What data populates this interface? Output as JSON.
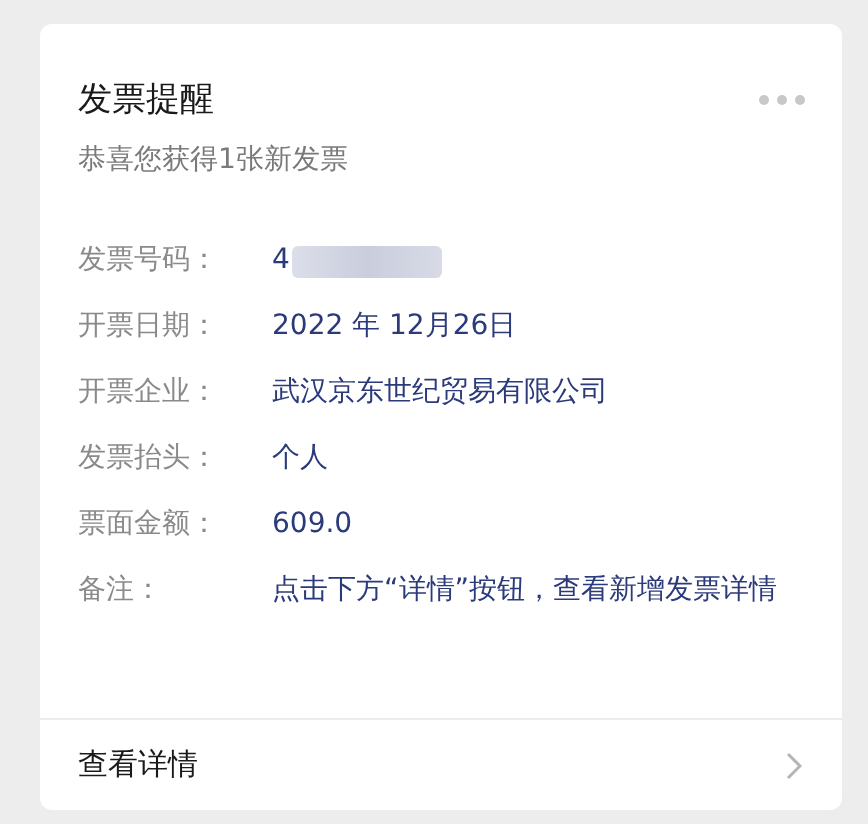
{
  "card": {
    "title": "发票提醒",
    "subtitle": "恭喜您获得1张新发票",
    "fields": [
      {
        "label": "发票号码：",
        "value": "4",
        "redacted": true
      },
      {
        "label": "开票日期：",
        "value": "2022 年 12月26日",
        "redacted": false
      },
      {
        "label": "开票企业：",
        "value": "武汉京东世纪贸易有限公司",
        "redacted": false
      },
      {
        "label": "发票抬头：",
        "value": "个人",
        "redacted": false
      },
      {
        "label": "票面金额：",
        "value": "609.0",
        "redacted": false
      },
      {
        "label": "备注：",
        "value": "点击下方“详情”按钮，查看新增发票详情",
        "redacted": false
      }
    ],
    "footer_link": "查看详情"
  }
}
